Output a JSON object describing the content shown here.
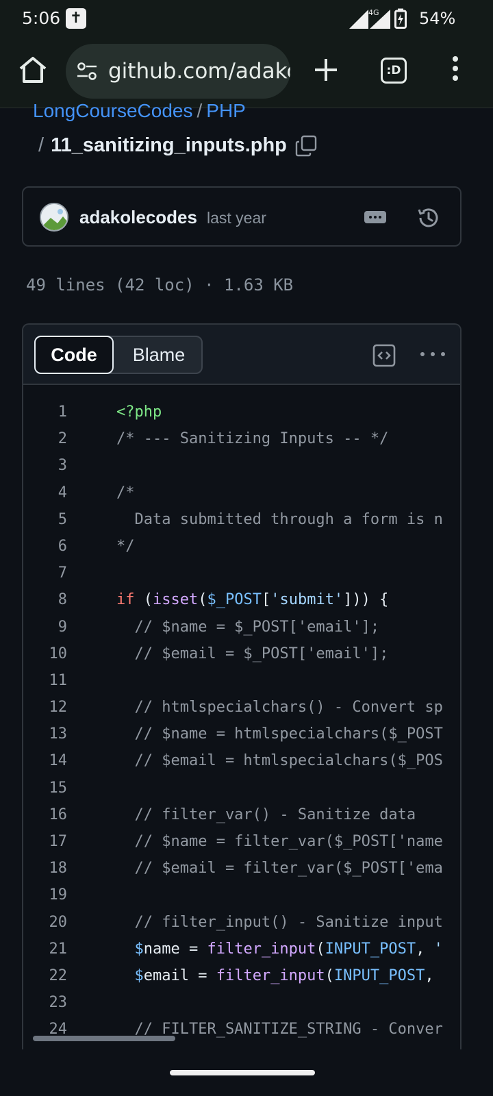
{
  "status_bar": {
    "time": "5:06",
    "network": "4G",
    "battery": "54%"
  },
  "browser": {
    "url": "github.com/adakolecodes",
    "tabs_label": ":D"
  },
  "breadcrumb": {
    "repo": "LongCourseCodes",
    "folder": "PHP",
    "separator": "/",
    "file": "11_sanitizing_inputs.php"
  },
  "commit": {
    "author": "adakolecodes",
    "time": "last year"
  },
  "file_meta": "49 lines (42 loc) · 1.63 KB",
  "view_tabs": {
    "code": "Code",
    "blame": "Blame"
  },
  "code": [
    {
      "n": "1",
      "tokens": [
        [
          "tag",
          "<?php"
        ]
      ]
    },
    {
      "n": "2",
      "tokens": [
        [
          "c",
          "/* --- Sanitizing Inputs -- */"
        ]
      ]
    },
    {
      "n": "3",
      "tokens": []
    },
    {
      "n": "4",
      "tokens": [
        [
          "c",
          "/*"
        ]
      ]
    },
    {
      "n": "5",
      "tokens": [
        [
          "c",
          "  Data submitted through a form is n"
        ]
      ]
    },
    {
      "n": "6",
      "tokens": [
        [
          "c",
          "*/"
        ]
      ]
    },
    {
      "n": "7",
      "tokens": []
    },
    {
      "n": "8",
      "tokens": [
        [
          "k",
          "if"
        ],
        [
          "",
          " ("
        ],
        [
          "f",
          "isset"
        ],
        [
          "",
          "("
        ],
        [
          "v",
          "$_POST"
        ],
        [
          "",
          "["
        ],
        [
          "s",
          "'submit'"
        ],
        [
          "",
          "])) {"
        ]
      ]
    },
    {
      "n": "9",
      "tokens": [
        [
          "c",
          "  // $name = $_POST['email'];"
        ]
      ]
    },
    {
      "n": "10",
      "tokens": [
        [
          "c",
          "  // $email = $_POST['email'];"
        ]
      ]
    },
    {
      "n": "11",
      "tokens": []
    },
    {
      "n": "12",
      "tokens": [
        [
          "c",
          "  // htmlspecialchars() - Convert sp"
        ]
      ]
    },
    {
      "n": "13",
      "tokens": [
        [
          "c",
          "  // $name = htmlspecialchars($_POST"
        ]
      ]
    },
    {
      "n": "14",
      "tokens": [
        [
          "c",
          "  // $email = htmlspecialchars($_POS"
        ]
      ]
    },
    {
      "n": "15",
      "tokens": []
    },
    {
      "n": "16",
      "tokens": [
        [
          "c",
          "  // filter_var() - Sanitize data"
        ]
      ]
    },
    {
      "n": "17",
      "tokens": [
        [
          "c",
          "  // $name = filter_var($_POST['name"
        ]
      ]
    },
    {
      "n": "18",
      "tokens": [
        [
          "c",
          "  // $email = filter_var($_POST['ema"
        ]
      ]
    },
    {
      "n": "19",
      "tokens": []
    },
    {
      "n": "20",
      "tokens": [
        [
          "c",
          "  // filter_input() - Sanitize input"
        ]
      ]
    },
    {
      "n": "21",
      "tokens": [
        [
          "",
          "  "
        ],
        [
          "v",
          "$"
        ],
        [
          "",
          "name = "
        ],
        [
          "f",
          "filter_input"
        ],
        [
          "",
          "("
        ],
        [
          "v",
          "INPUT_POST"
        ],
        [
          "",
          ", "
        ],
        [
          "s",
          "'"
        ]
      ]
    },
    {
      "n": "22",
      "tokens": [
        [
          "",
          "  "
        ],
        [
          "v",
          "$"
        ],
        [
          "",
          "email = "
        ],
        [
          "f",
          "filter_input"
        ],
        [
          "",
          "("
        ],
        [
          "v",
          "INPUT_POST"
        ],
        [
          "",
          ","
        ]
      ]
    },
    {
      "n": "23",
      "tokens": []
    },
    {
      "n": "24",
      "tokens": [
        [
          "c",
          "  // FILTER_SANITIZE_STRING - Conver"
        ]
      ]
    }
  ]
}
